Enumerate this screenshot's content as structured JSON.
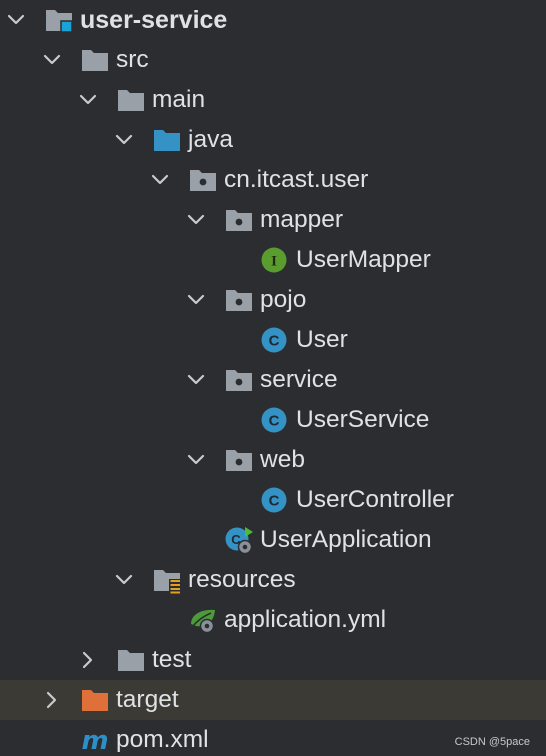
{
  "tree": [
    {
      "label": "user-service",
      "depth": 0,
      "expanded": true,
      "icon": "module-folder-icon",
      "bold": true,
      "name": "tree-item-user-service"
    },
    {
      "label": "src",
      "depth": 1,
      "expanded": true,
      "icon": "folder-icon",
      "name": "tree-item-src"
    },
    {
      "label": "main",
      "depth": 2,
      "expanded": true,
      "icon": "folder-icon",
      "name": "tree-item-main"
    },
    {
      "label": "java",
      "depth": 3,
      "expanded": true,
      "icon": "source-folder-icon",
      "name": "tree-item-java"
    },
    {
      "label": "cn.itcast.user",
      "depth": 4,
      "expanded": true,
      "icon": "package-icon",
      "name": "tree-item-cn-itcast-user"
    },
    {
      "label": "mapper",
      "depth": 5,
      "expanded": true,
      "icon": "package-icon",
      "name": "tree-item-mapper"
    },
    {
      "label": "UserMapper",
      "depth": 6,
      "icon": "interface-icon",
      "name": "tree-item-usermapper"
    },
    {
      "label": "pojo",
      "depth": 5,
      "expanded": true,
      "icon": "package-icon",
      "name": "tree-item-pojo"
    },
    {
      "label": "User",
      "depth": 6,
      "icon": "class-icon",
      "name": "tree-item-user"
    },
    {
      "label": "service",
      "depth": 5,
      "expanded": true,
      "icon": "package-icon",
      "name": "tree-item-service"
    },
    {
      "label": "UserService",
      "depth": 6,
      "icon": "class-icon",
      "name": "tree-item-userservice"
    },
    {
      "label": "web",
      "depth": 5,
      "expanded": true,
      "icon": "package-icon",
      "name": "tree-item-web"
    },
    {
      "label": "UserController",
      "depth": 6,
      "icon": "class-icon",
      "name": "tree-item-usercontroller"
    },
    {
      "label": "UserApplication",
      "depth": 5,
      "icon": "spring-boot-app-icon",
      "name": "tree-item-userapplication"
    },
    {
      "label": "resources",
      "depth": 3,
      "expanded": true,
      "icon": "resources-folder-icon",
      "name": "tree-item-resources"
    },
    {
      "label": "application.yml",
      "depth": 4,
      "icon": "spring-yaml-icon",
      "name": "tree-item-application-yml"
    },
    {
      "label": "test",
      "depth": 2,
      "expanded": false,
      "icon": "folder-icon",
      "name": "tree-item-test"
    },
    {
      "label": "target",
      "depth": 1,
      "expanded": false,
      "icon": "excluded-folder-icon",
      "highlight": true,
      "name": "tree-item-target"
    },
    {
      "label": "pom.xml",
      "depth": 1,
      "icon": "maven-icon",
      "name": "tree-item-pom-xml"
    }
  ],
  "watermark": "CSDN @5pace",
  "colors": {
    "background": "#2b2d30",
    "text": "#dfe1e5",
    "folder": "#9aa0a8",
    "source_folder": "#3592c4",
    "excluded_folder": "#e0703a",
    "class": "#3592c4",
    "interface": "#5b9c2e",
    "maven": "#2d8fc9",
    "highlight_row": "#3c3a34"
  }
}
